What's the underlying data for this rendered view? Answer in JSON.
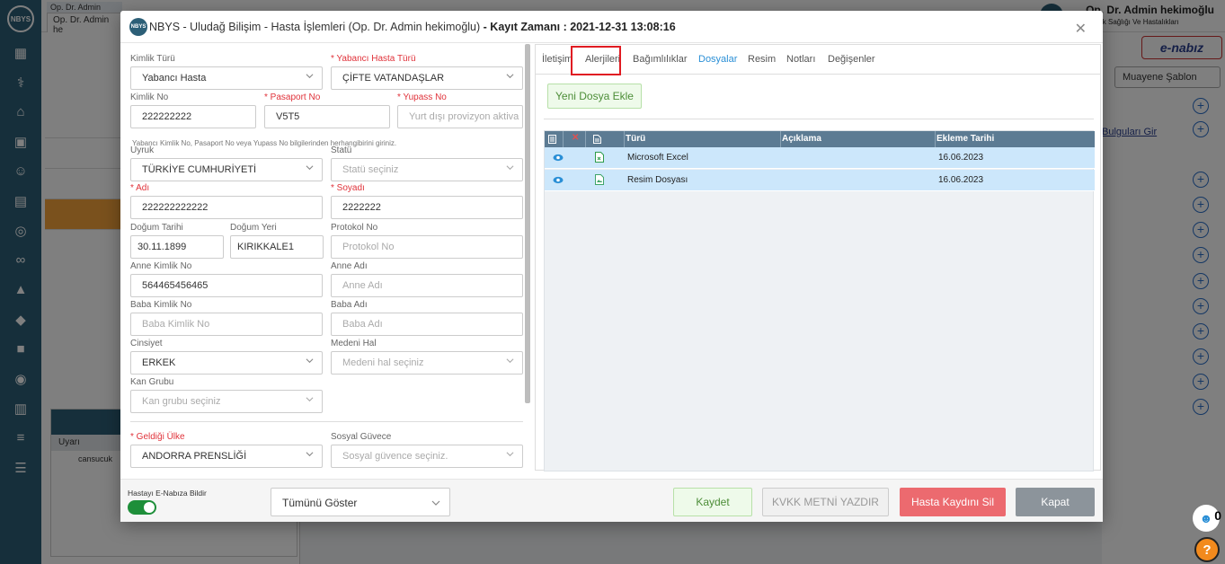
{
  "background": {
    "tab_title": "Op. Dr. Admin hekimoğlu",
    "tab_name": "Op. Dr. Admin he",
    "user_name": "Op. Dr. Admin hekimoğlu",
    "user_dept": "Çocuk Sağlığı Ve Hastalıkları",
    "sablon_label": "Muayene Şablon",
    "link_text": "Bulguları Gir",
    "patient_name": "cansucuk",
    "uyari_label": "Uyarı",
    "badge_count": "0",
    "help": "?",
    "enabiz": "e-nabız"
  },
  "modal": {
    "title": "NBYS - Uludağ Bilişim - Hasta İşlemleri (Op. Dr. Admin hekimoğlu)",
    "record_time": "- Kayıt Zamanı : 2021-12-31 13:08:16",
    "logo": "NBYS"
  },
  "form": {
    "kimlik_turu": {
      "label": "Kimlik Türü",
      "value": "Yabancı Hasta"
    },
    "yabanci_hasta_turu": {
      "label": "* Yabancı Hasta Türü",
      "value": "ÇİFTE VATANDAŞLAR"
    },
    "kimlik_no": {
      "label": "Kimlik No",
      "value": "222222222"
    },
    "pasaport_no": {
      "label": "* Pasaport No",
      "value": "V5T5"
    },
    "yupass_no": {
      "label": "* Yupass No",
      "placeholder": "Yurt dışı provizyon aktiva"
    },
    "hint": "Yabancı Kimlik No, Pasaport No veya Yupass No bilgilerinden herhangibirini giriniz.",
    "uyruk": {
      "label": "Uyruk",
      "value": "TÜRKİYE CUMHURİYETİ"
    },
    "statu": {
      "label": "Statü",
      "placeholder": "Statü seçiniz"
    },
    "adi": {
      "label": "* Adı",
      "value": "222222222222"
    },
    "soyadi": {
      "label": "* Soyadı",
      "value": "2222222"
    },
    "dogum_tarihi": {
      "label": "Doğum Tarihi",
      "value": "30.11.1899"
    },
    "dogum_yeri": {
      "label": "Doğum Yeri",
      "value": "KIRIKKALE1"
    },
    "protokol_no": {
      "label": "Protokol No",
      "placeholder": "Protokol No"
    },
    "anne_kimlik_no": {
      "label": "Anne Kimlik No",
      "value": "564465456465"
    },
    "anne_adi": {
      "label": "Anne Adı",
      "placeholder": "Anne Adı"
    },
    "baba_kimlik_no": {
      "label": "Baba Kimlik No",
      "placeholder": "Baba Kimlik No"
    },
    "baba_adi": {
      "label": "Baba Adı",
      "placeholder": "Baba Adı"
    },
    "cinsiyet": {
      "label": "Cinsiyet",
      "value": "ERKEK"
    },
    "medeni_hal": {
      "label": "Medeni Hal",
      "placeholder": "Medeni hal seçiniz"
    },
    "kan_grubu": {
      "label": "Kan Grubu",
      "placeholder": "Kan grubu seçiniz"
    },
    "geldigi_ulke": {
      "label": "* Geldiği Ülke",
      "value": "ANDORRA PRENSLİĞİ"
    },
    "sosyal_guvence": {
      "label": "Sosyal Güvece",
      "placeholder": "Sosyal güvence seçiniz."
    }
  },
  "tabs": [
    "İletişim",
    "Alerjileri",
    "Bağımlılıklar",
    "Dosyalar",
    "Resim",
    "Notları",
    "Değişenler"
  ],
  "active_tab": "Dosyalar",
  "files": {
    "new_button": "Yeni Dosya Ekle",
    "columns": [
      "Türü",
      "Açıklama",
      "Ekleme Tarihi"
    ],
    "rows": [
      {
        "type": "Microsoft Excel",
        "description": "",
        "date": "16.06.2023"
      },
      {
        "type": "Resim Dosyası",
        "description": "",
        "date": "16.06.2023"
      }
    ]
  },
  "footer": {
    "toggle_label": "Hastayı E-Nabıza Bildir",
    "toggle_on": true,
    "show_all": "Tümünü Göster",
    "save": "Kaydet",
    "kvkk": "KVKK METNİ YAZDIR",
    "delete": "Hasta Kaydını Sil",
    "close": "Kapat"
  },
  "colors": {
    "accent": "#2a8fd6",
    "danger": "#ec6a6f",
    "success": "#4c8d37",
    "header_grid": "#5c7b93",
    "row_selected": "#cce7fb",
    "sidebar": "#2c5f77"
  }
}
